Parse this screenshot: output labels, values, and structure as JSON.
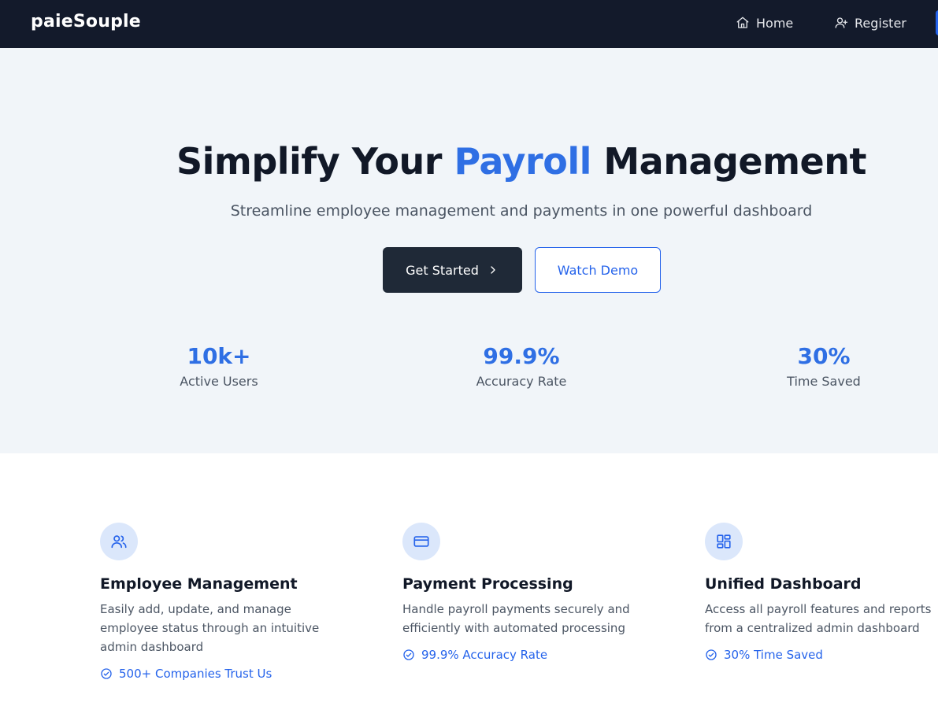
{
  "nav": {
    "brand": "paieSouple",
    "links": [
      {
        "label": "Home",
        "icon": "home-icon"
      },
      {
        "label": "Register",
        "icon": "user-plus-icon"
      }
    ]
  },
  "hero": {
    "title_pre": "Simplify Your ",
    "title_accent": "Payroll",
    "title_post": " Management",
    "subtitle": "Streamline employee management and payments in one powerful dashboard",
    "primary_button": "Get Started",
    "secondary_button": "Watch Demo",
    "stats": [
      {
        "value": "10k+",
        "label": "Active Users"
      },
      {
        "value": "99.9%",
        "label": "Accuracy Rate"
      },
      {
        "value": "30%",
        "label": "Time Saved"
      }
    ]
  },
  "features": [
    {
      "icon": "users-icon",
      "title": "Employee Management",
      "description": "Easily add, update, and manage employee status through an intuitive admin dashboard",
      "badge": "500+ Companies Trust Us"
    },
    {
      "icon": "credit-card-icon",
      "title": "Payment Processing",
      "description": "Handle payroll payments securely and efficiently with automated processing",
      "badge": "99.9% Accuracy Rate"
    },
    {
      "icon": "dashboard-icon",
      "title": "Unified Dashboard",
      "description": "Access all payroll features and reports from a centralized admin dashboard",
      "badge": "30% Time Saved"
    }
  ],
  "colors": {
    "navbar": "#131a2b",
    "accent": "#2f6fe4",
    "hero_background": "#f1f5f9",
    "primary_button": "#1f2937"
  }
}
